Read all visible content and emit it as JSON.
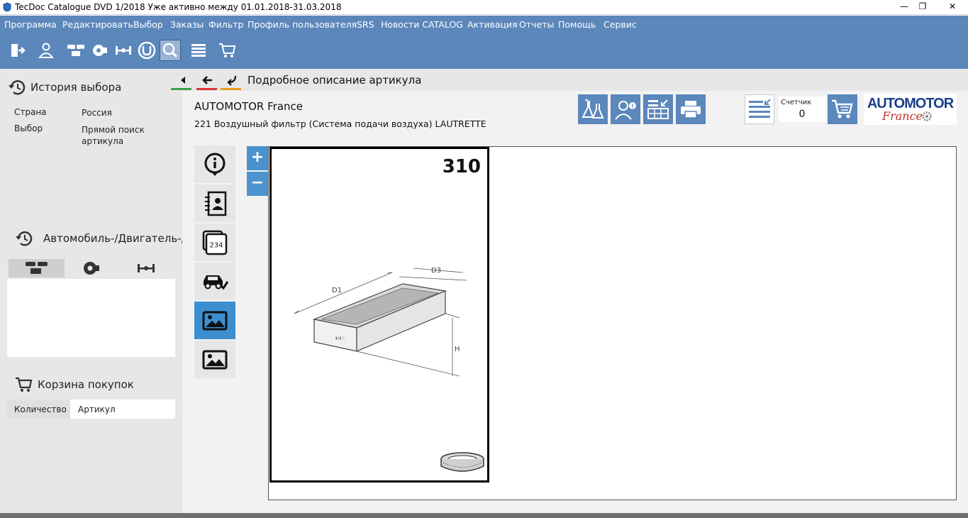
{
  "window": {
    "title": "TecDoc Catalogue DVD   1/2018 Уже активно между 01.01.2018-31.03.2018",
    "min_glyph": "—",
    "max_glyph": "❐",
    "close_glyph": "✕"
  },
  "menu": [
    {
      "label": "Программа"
    },
    {
      "label": "Редактировать"
    },
    {
      "label": "Выбор"
    },
    {
      "label": "Заказы"
    },
    {
      "label": "Фильтр"
    },
    {
      "label": "Профиль пользователя"
    },
    {
      "label": "SRS"
    },
    {
      "label": "Новости CATALOG"
    },
    {
      "label": "Активация"
    },
    {
      "label": "Отчеты"
    },
    {
      "label": "Помощь"
    },
    {
      "label": "Сервис"
    }
  ],
  "toolbar": {
    "icons": [
      "exit-icon",
      "user-icon",
      "vehicles-icon",
      "engine-icon",
      "axle-icon",
      "universal-icon",
      "search-icon",
      "list-icon",
      "cart-icon"
    ],
    "active_icon": "search-icon"
  },
  "history": {
    "title": "История выбора",
    "rows": [
      {
        "key": "Страна",
        "value": "Россия"
      },
      {
        "key": "Выбор",
        "value": "Прямой поиск артикула"
      }
    ]
  },
  "vehicle": {
    "title": "Автомобиль-/Двигатель-/",
    "tabs": [
      "cars-trucks-icon",
      "engine-icon",
      "axle-icon"
    ]
  },
  "cart": {
    "title": "Корзина покупок",
    "col_quantity": "Количество",
    "col_article": "Артикул"
  },
  "nav": {
    "title": "Подробное описание артикула"
  },
  "article": {
    "brand": "AUTOMOTOR France",
    "description": "221 Воздушный фильтр (Система подачи воздуха) LAUTRETTE"
  },
  "counter": {
    "label": "Счетчик",
    "value": "0"
  },
  "logo": {
    "line1": "AUTOMOTOR",
    "line2": "France"
  },
  "viewer": {
    "zoom_in": "+",
    "zoom_out": "−",
    "picture_number": "310",
    "dim_labels": [
      "D1",
      "D3",
      "H"
    ]
  },
  "colors": {
    "menubar": "#5b87bb",
    "accent": "#3b8fd0",
    "panel": "#e7e7e7"
  }
}
